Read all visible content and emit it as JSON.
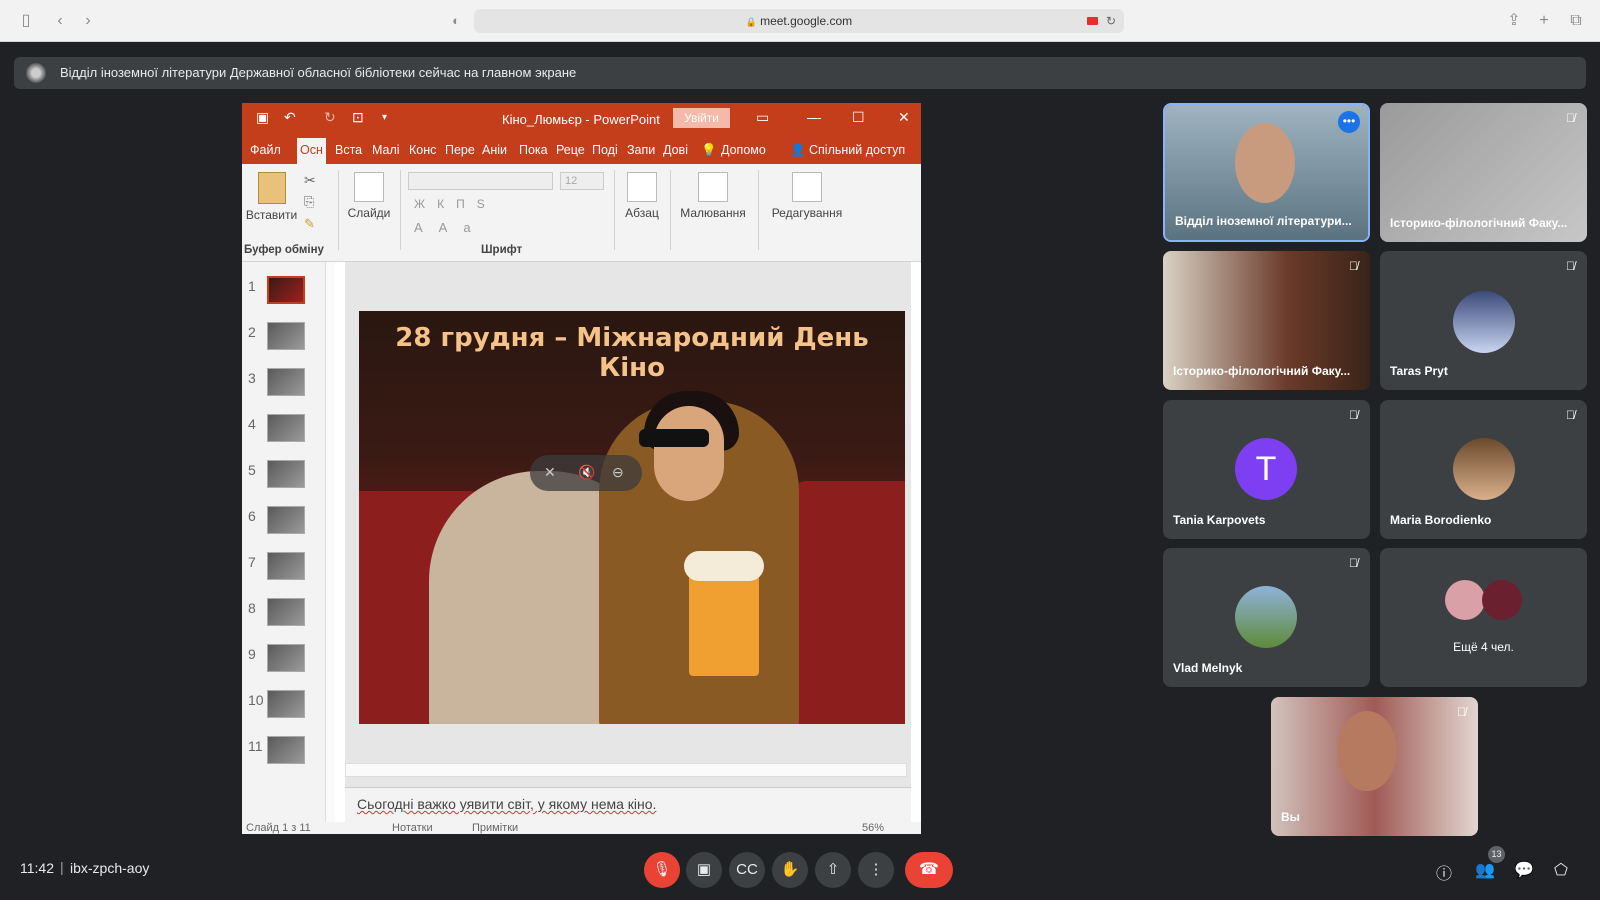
{
  "browser": {
    "url": "meet.google.com"
  },
  "banner": {
    "text": "Відділ іноземної літератури Державної обласної бібліотеки сейчас на главном экране"
  },
  "ppt": {
    "title": "Кіно_Люмьєр - PowerPoint",
    "login": "Увійти",
    "tabs": [
      "Файл",
      "Осн",
      "Вста",
      "Малі",
      "Конс",
      "Пере",
      "Аніи",
      "Пока",
      "Реце",
      "Поді",
      "Запи",
      "Дові"
    ],
    "help": "Допомо",
    "share": "Спільний доступ",
    "ribbon": {
      "paste": "Вставити",
      "clipboard": "Буфер обміну",
      "slides": "Слайди",
      "font": "Шрифт",
      "font_size": "12",
      "paragraph": "Абзац",
      "drawing": "Малювання",
      "editing": "Редагування"
    },
    "slide_numbers": [
      "1",
      "2",
      "3",
      "4",
      "5",
      "6",
      "7",
      "8",
      "9",
      "10",
      "11"
    ],
    "slide_title": "28 грудня – Міжнародний День Кіно",
    "notes_text": "Сьогодні важко уявити світ, у якому нема кіно.",
    "status": {
      "slide": "Слайд 1 з 11",
      "notes": "Нотатки",
      "comments": "Примітки",
      "zoom": "56%"
    }
  },
  "participants": [
    {
      "name": "Відділ іноземної літератури..."
    },
    {
      "name": "Історико-філологічний Факу..."
    },
    {
      "name": "Історико-філологічний Факу..."
    },
    {
      "name": "Taras Pryt"
    },
    {
      "name": "Tania Karpovets",
      "initial": "T"
    },
    {
      "name": "Maria Borodienko"
    },
    {
      "name": "Vlad Melnyk"
    },
    {
      "name": "Ещё 4 чел."
    },
    {
      "name": "Вы"
    }
  ],
  "meeting": {
    "time": "11:42",
    "code": "ibx-zpch-aoy",
    "people_count": "13"
  }
}
